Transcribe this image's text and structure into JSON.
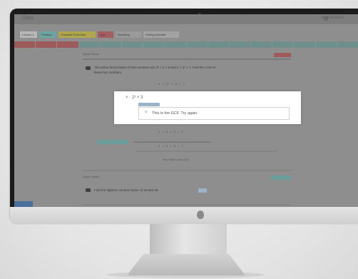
{
  "app": {
    "title": "Class",
    "user": "Student Name"
  },
  "tabs": [
    {
      "label": "Lesson 1"
    },
    {
      "label": "Practice"
    },
    {
      "label": "Grammar Exercises"
    },
    {
      "label": "Quiz"
    },
    {
      "label": "Speaking"
    },
    {
      "label": "Writing Activities"
    }
  ],
  "progress": {
    "segments": [
      "#9d5a5a",
      "#9d5a5a",
      "#9d5a5a",
      "#6e8f8c",
      "#6e8f8c",
      "#6e8f8c",
      "#6e8f8c",
      "#6e8f8c",
      "#6e8f8c",
      "#6e8f8c",
      "#6e8f8c",
      "#6e8f8c",
      "#6e8f8c",
      "#6e8f8c",
      "#6e8f8c",
      "#6e8f8c"
    ]
  },
  "question1": {
    "label": "Quick Check",
    "text_line1": "The prime factorization of two numbers are 2³ × 3 × 5 and 2 × 3² × 7. Find the LCM of",
    "text_line2": "these two numbers."
  },
  "modal": {
    "header": "×  ·  2³ × 3",
    "close_symbol": "×",
    "message": "This is the GCF. Try again."
  },
  "answers": {
    "option_a": "2 × 3² × 5 × 7",
    "option_b": "2 × 3 × 5 × 7",
    "feedback": "Yes! This is the LCM."
  },
  "question2": {
    "label": "Quick Check",
    "text": "Find the highest common factor of 15 and 40."
  },
  "icons": {
    "settings": "gear-icon",
    "avatar": "person-icon"
  },
  "colors": {
    "accent": "#6aa5a3",
    "warning": "#a55d5d",
    "modal_bg": "#ffffff"
  }
}
